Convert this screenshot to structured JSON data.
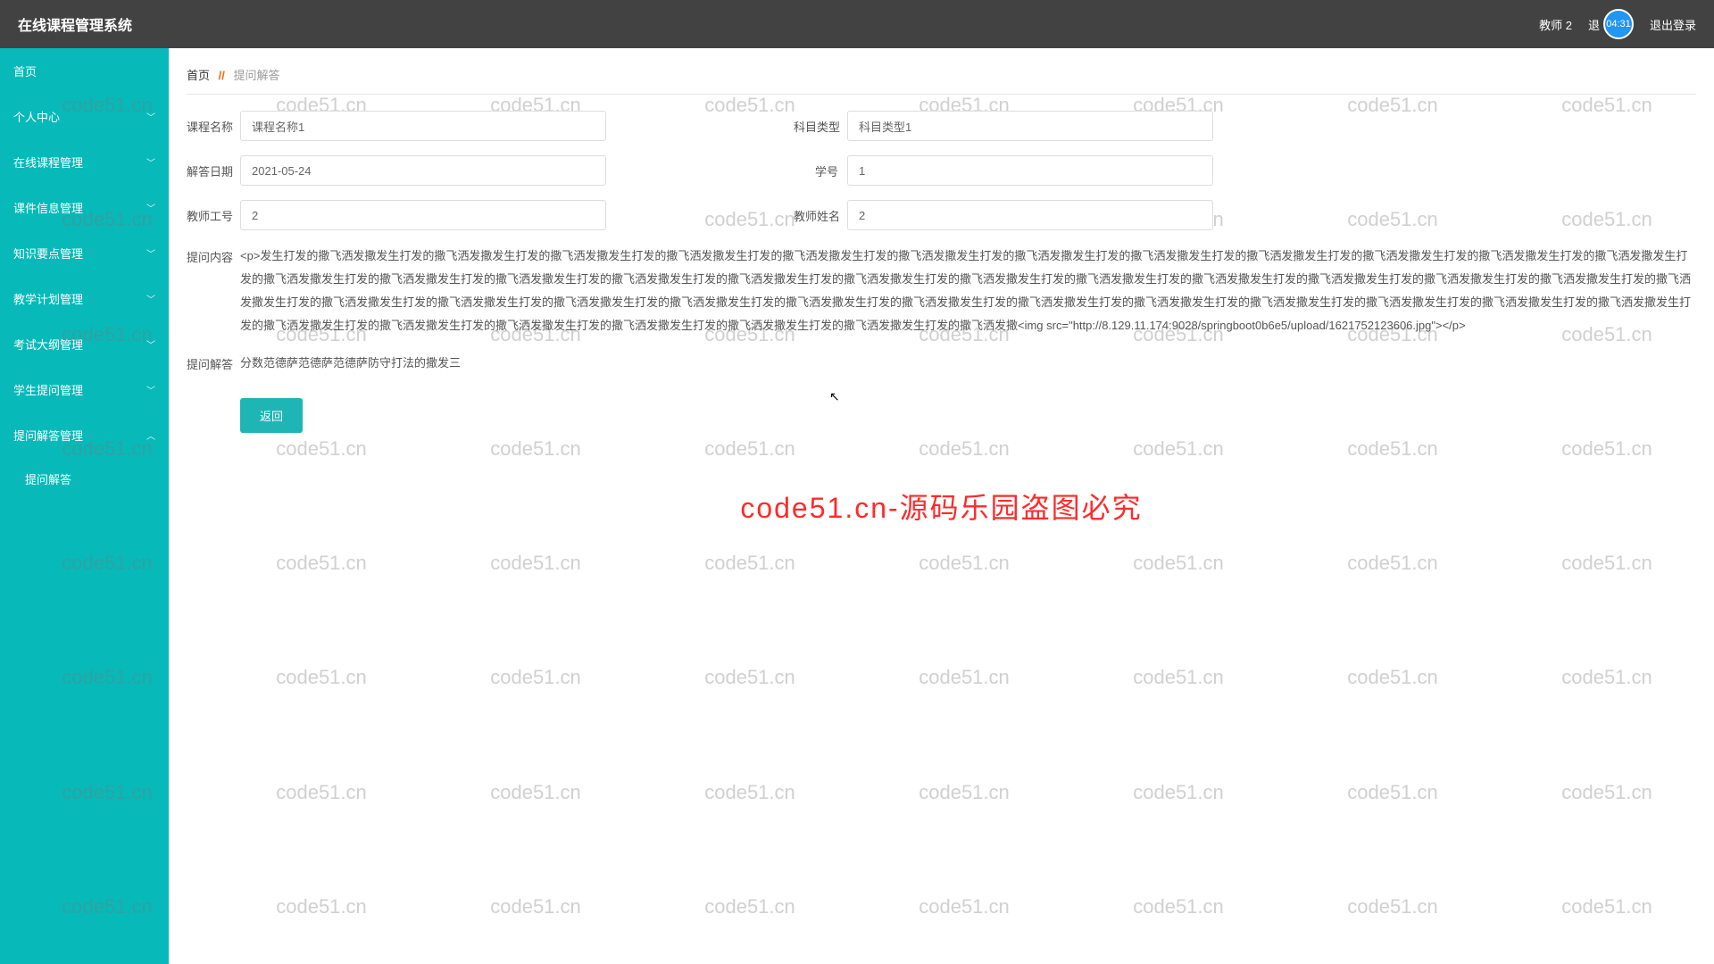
{
  "header": {
    "title": "在线课程管理系统",
    "user": "教师 2",
    "logout_partial": "退",
    "clock": "04:31",
    "logout": "退出登录"
  },
  "sidebar": {
    "items": [
      {
        "label": "首页",
        "expandable": false
      },
      {
        "label": "个人中心",
        "expandable": true
      },
      {
        "label": "在线课程管理",
        "expandable": true
      },
      {
        "label": "课件信息管理",
        "expandable": true
      },
      {
        "label": "知识要点管理",
        "expandable": true
      },
      {
        "label": "教学计划管理",
        "expandable": true
      },
      {
        "label": "考试大纲管理",
        "expandable": true
      },
      {
        "label": "学生提问管理",
        "expandable": true
      },
      {
        "label": "提问解答管理",
        "expandable": true,
        "open": true
      },
      {
        "label": "提问解答",
        "sub": true
      }
    ]
  },
  "breadcrumb": {
    "home": "首页",
    "sep": "//",
    "current": "提问解答"
  },
  "form": {
    "labels": {
      "course_name": "课程名称",
      "subject_type": "科目类型",
      "answer_date": "解答日期",
      "student_no": "学号",
      "teacher_no": "教师工号",
      "teacher_name": "教师姓名",
      "question_content": "提问内容",
      "question_answer": "提问解答"
    },
    "values": {
      "course_name": "课程名称1",
      "subject_type": "科目类型1",
      "answer_date": "2021-05-24",
      "student_no": "1",
      "teacher_no": "2",
      "teacher_name": "2",
      "question_content": "<p>发生打发的撒飞洒发撒发生打发的撒飞洒发撒发生打发的撒飞洒发撒发生打发的撒飞洒发撒发生打发的撒飞洒发撒发生打发的撒飞洒发撒发生打发的撒飞洒发撒发生打发的撒飞洒发撒发生打发的撒飞洒发撒发生打发的撒飞洒发撒发生打发的撒飞洒发撒发生打发的撒飞洒发撒发生打发的撒飞洒发撒发生打发的撒飞洒发撒发生打发的撒飞洒发撒发生打发的撒飞洒发撒发生打发的撒飞洒发撒发生打发的撒飞洒发撒发生打发的撒飞洒发撒发生打发的撒飞洒发撒发生打发的撒飞洒发撒发生打发的撒飞洒发撒发生打发的撒飞洒发撒发生打发的撒飞洒发撒发生打发的撒飞洒发撒发生打发的撒飞洒发撒发生打发的撒飞洒发撒发生打发的撒飞洒发撒发生打发的撒飞洒发撒发生打发的撒飞洒发撒发生打发的撒飞洒发撒发生打发的撒飞洒发撒发生打发的撒飞洒发撒发生打发的撒飞洒发撒发生打发的撒飞洒发撒发生打发的撒飞洒发撒发生打发的撒飞洒发撒发生打发的撒飞洒发撒发生打发的撒飞洒发撒发生打发的撒飞洒发撒发生打发的撒飞洒发撒发生打发的撒飞洒发撒发生打发的撒飞洒发撒发生打发的撒飞洒发撒<img src=\"http://8.129.11.174:9028/springboot0b6e5/upload/1621752123606.jpg\"></p>",
      "question_answer": "分数范德萨范德萨范德萨防守打法的撒发三"
    },
    "return_btn": "返回"
  },
  "watermark": {
    "small": "code51.cn",
    "big": "code51.cn-源码乐园盗图必究"
  }
}
